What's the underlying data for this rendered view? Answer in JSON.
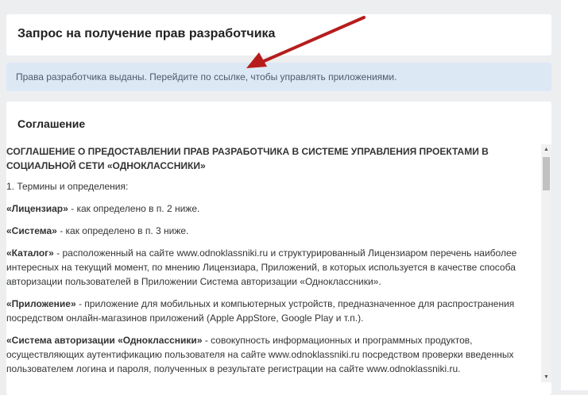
{
  "page": {
    "title": "Запрос на получение прав разработчика",
    "notice": "Права разработчика выданы. Перейдите по ссылке, чтобы управлять приложениями."
  },
  "agreement": {
    "heading": "Соглашение",
    "doc_title": "СОГЛАШЕНИЕ О ПРЕДОСТАВЛЕНИИ ПРАВ РАЗРАБОТЧИКА В СИСТЕМЕ УПРАВЛЕНИЯ ПРОЕКТАМИ В СОЦИАЛЬНОЙ СЕТИ «ОДНОКЛАССНИКИ»",
    "section_1": "1. Термины и определения:",
    "terms": [
      {
        "term": "«Лицензиар»",
        "definition": " - как определено в п. 2 ниже."
      },
      {
        "term": "«Система»",
        "definition": " - как определено в п. 3 ниже."
      },
      {
        "term": "«Каталог»",
        "definition": " - расположенный на сайте www.odnoklassniki.ru и структурированный Лицензиаром перечень наиболее интересных на текущий момент, по мнению Лицензиара, Приложений, в которых используется в качестве способа авторизации пользователей в Приложении Система авторизации «Одноклассники»."
      },
      {
        "term": "«Приложение»",
        "definition": " - приложение для мобильных и компьютерных устройств, предназначенное для распространения посредством онлайн-магазинов приложений (Apple AppStore, Google Play и т.п.)."
      },
      {
        "term": "«Система авторизации «Одноклассники»",
        "definition": " - совокупность информационных и программных продуктов, осуществляющих аутентификацию пользователя на сайте www.odnoklassniki.ru посредством проверки введенных пользователем логина и пароля, полученных в результате регистрации на сайте www.odnoklassniki.ru."
      }
    ]
  },
  "colors": {
    "background": "#edeef0",
    "notice_bg": "#dde8f5",
    "annotation_arrow": "#b71c1c"
  },
  "icons": {
    "scroll_up": "triangle-up",
    "scroll_down": "triangle-down"
  }
}
